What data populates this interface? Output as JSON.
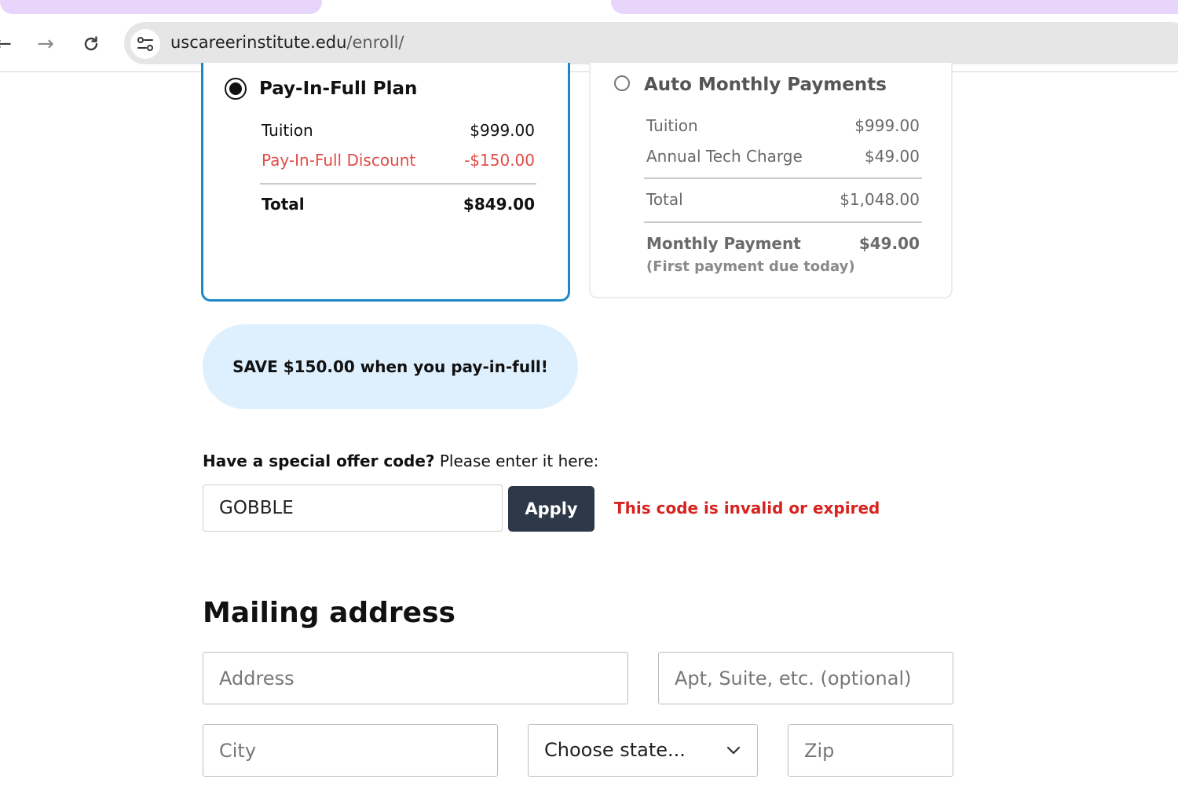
{
  "browser": {
    "url_domain": "uscareerinstitute.edu",
    "url_path": "/enroll/",
    "icons": {
      "back": "arrow-left-icon",
      "forward": "arrow-right-icon",
      "reload": "reload-icon",
      "site_info": "site-settings-icon"
    }
  },
  "plans": {
    "pay_in_full": {
      "title": "Pay-In-Full Plan",
      "selected": true,
      "rows": [
        {
          "label": "Tuition",
          "value": "$999.00"
        },
        {
          "label": "Pay-In-Full Discount",
          "value": "-$150.00"
        }
      ],
      "total_label": "Total",
      "total_value": "$849.00"
    },
    "monthly": {
      "title": "Auto Monthly Payments",
      "selected": false,
      "rows": [
        {
          "label": "Tuition",
          "value": "$999.00"
        },
        {
          "label": "Annual Tech Charge",
          "value": "$49.00"
        }
      ],
      "total_label": "Total",
      "total_value": "$1,048.00",
      "payment_label": "Monthly Payment",
      "payment_value": "$49.00",
      "payment_note": "(First payment due today)"
    }
  },
  "promo": {
    "save_message": "SAVE $150.00 when you pay-in-full!"
  },
  "offer": {
    "prompt_bold": "Have a special offer code?",
    "prompt_rest": " Please enter it here:",
    "code_value": "GOBBLE",
    "apply_label": "Apply",
    "error": "This code is invalid or expired"
  },
  "mailing": {
    "title": "Mailing address",
    "address_placeholder": "Address",
    "apt_placeholder": "Apt, Suite, etc. (optional)",
    "city_placeholder": "City",
    "state_selected": "Choose state...",
    "zip_placeholder": "Zip"
  },
  "colors": {
    "selected_border": "#1e88c7",
    "discount_red": "#e24b46",
    "error_red": "#d6231f",
    "apply_bg": "#2d3849",
    "promo_bg": "#def0fe"
  }
}
